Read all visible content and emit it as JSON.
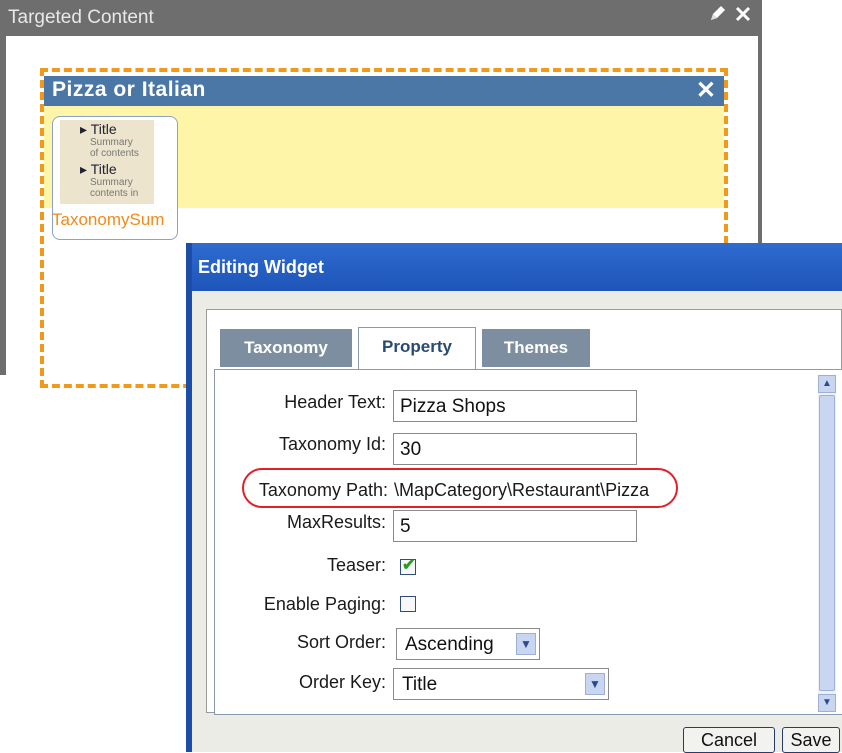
{
  "background_panel": {
    "title": "Targeted Content",
    "icons": [
      "edit-icon",
      "close-icon"
    ]
  },
  "widget": {
    "title": "Pizza or Italian",
    "thumbnail": {
      "item1_title": "Title",
      "item1_summary_a": "Summary",
      "item1_summary_b": "of contents",
      "item2_title": "Title",
      "item2_summary_a": "Summary",
      "item2_summary_b": "contents in",
      "label": "TaxonomySum"
    }
  },
  "dialog": {
    "title": "Editing Widget",
    "tabs": [
      {
        "label": "Taxonomy",
        "active": false
      },
      {
        "label": "Property",
        "active": true
      },
      {
        "label": "Themes",
        "active": false
      }
    ],
    "fields": {
      "header_text_label": "Header Text:",
      "header_text_value": "Pizza Shops",
      "taxonomy_id_label": "Taxonomy Id:",
      "taxonomy_id_value": "30",
      "taxonomy_path_label": "Taxonomy Path:",
      "taxonomy_path_value": "\\MapCategory\\Restaurant\\Pizza",
      "max_results_label": "MaxResults:",
      "max_results_value": "5",
      "teaser_label": "Teaser:",
      "teaser_checked": true,
      "enable_paging_label": "Enable Paging:",
      "enable_paging_checked": false,
      "sort_order_label": "Sort Order:",
      "sort_order_value": "Ascending",
      "order_key_label": "Order Key:",
      "order_key_value": "Title"
    },
    "buttons": {
      "cancel": "Cancel",
      "save": "Save"
    }
  },
  "colors": {
    "highlight": "#e0202a",
    "dialog_title_bg": "#2f6bd0",
    "widget_header_bg": "#4a77a6",
    "dash_border": "#f09a1a"
  }
}
